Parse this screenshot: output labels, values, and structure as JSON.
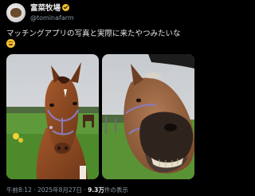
{
  "account": {
    "display_name": "富菜牧場",
    "handle": "@tominafarm",
    "verified": true,
    "badge_color": "#f4c024"
  },
  "tweet": {
    "text": "マッチングアプリの写真と実際に来たやつみたいな",
    "emoji": "sweat-smile-emoji"
  },
  "media": [
    {
      "icon": "horse-portrait-photo"
    },
    {
      "icon": "horse-closeup-photo"
    }
  ],
  "meta": {
    "time": "午前8:12",
    "separator": "·",
    "date": "2025年8月27日",
    "views": "9.3万",
    "views_label": "件の表示"
  }
}
